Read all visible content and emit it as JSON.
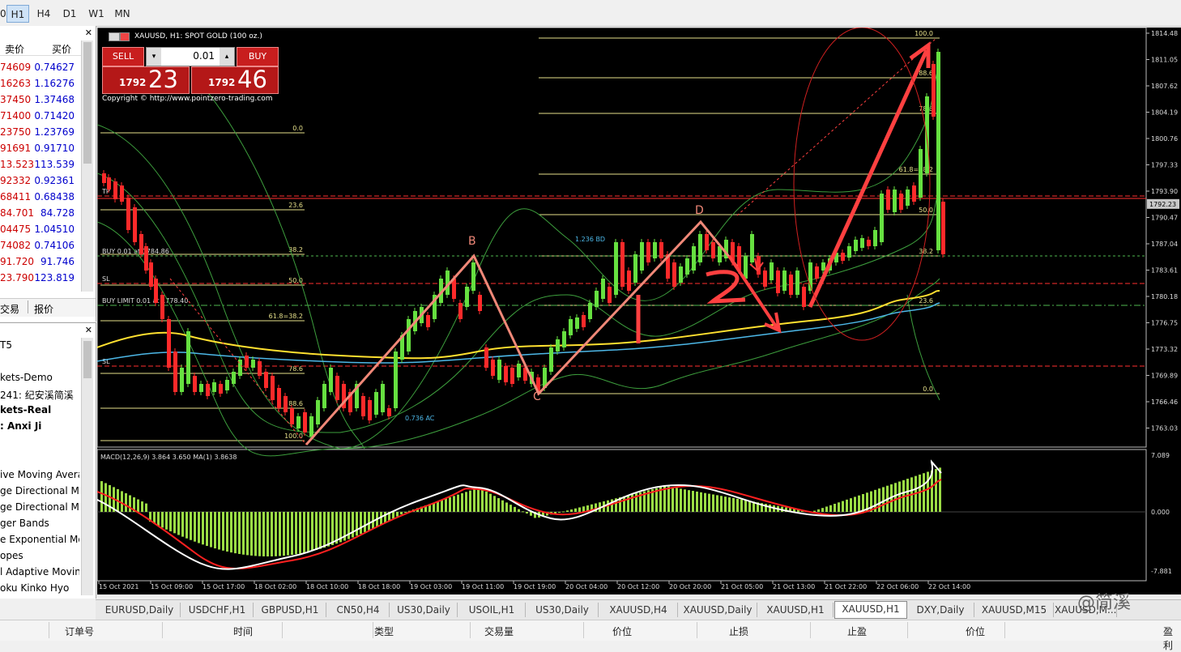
{
  "toolbar": {
    "timeframes": [
      "0",
      "H1",
      "H4",
      "D1",
      "W1",
      "MN"
    ],
    "active": "H1"
  },
  "market_watch": {
    "headers": [
      "卖价",
      "买价"
    ],
    "rows": [
      [
        "74609",
        "0.74627"
      ],
      [
        "16263",
        "1.16276"
      ],
      [
        "37450",
        "1.37468"
      ],
      [
        "71400",
        "0.71420"
      ],
      [
        "23750",
        "1.23769"
      ],
      [
        "91691",
        "0.91710"
      ],
      [
        "13.523",
        "113.539"
      ],
      [
        "92332",
        "0.92361"
      ],
      [
        "68411",
        "0.68438"
      ],
      [
        "84.701",
        "84.728"
      ],
      [
        "04475",
        "1.04510"
      ],
      [
        "74082",
        "0.74106"
      ],
      [
        "91.720",
        "91.746"
      ],
      [
        "23.790",
        "123.819"
      ]
    ],
    "tabs": [
      "交易",
      "报价"
    ]
  },
  "navigator": {
    "items": [
      "T5",
      "kets-Demo",
      "241: 纪安溪简溪",
      "kets-Real",
      ": Anxi Ji",
      "ive Moving Avera",
      "ge Directional Mo",
      "ge Directional Mo",
      "ger Bands",
      "e Exponential Mo",
      "opes",
      "l Adaptive Movin",
      "oku Kinko Hyo"
    ]
  },
  "chart": {
    "title": "XAUUSD, H1:  SPOT GOLD (100 oz.)",
    "sell_label": "SELL",
    "buy_label": "BUY",
    "lot": "0.01",
    "sell_small": "1792",
    "sell_big": "23",
    "buy_small": "1792",
    "buy_big": "46",
    "copyright": "Copyright © http://www.pointzero-trading.com",
    "current_price": "1792.23",
    "price_ticks": [
      "1814.48",
      "1811.05",
      "1807.62",
      "1804.19",
      "1800.76",
      "1797.33",
      "1793.90",
      "1790.47",
      "1787.04",
      "1783.61",
      "1780.18",
      "1776.75",
      "1773.32",
      "1769.89",
      "1766.46",
      "1763.03"
    ],
    "time_ticks": [
      "15 Oct 2021",
      "15 Oct 09:00",
      "15 Oct 17:00",
      "18 Oct 02:00",
      "18 Oct 10:00",
      "18 Oct 18:00",
      "19 Oct 03:00",
      "19 Oct 11:00",
      "19 Oct 19:00",
      "20 Oct 04:00",
      "20 Oct 12:00",
      "20 Oct 20:00",
      "21 Oct 05:00",
      "21 Oct 13:00",
      "21 Oct 22:00",
      "22 Oct 06:00",
      "22 Oct 14:00"
    ],
    "fib_left": [
      "0.0",
      "23.6",
      "38.2",
      "50.0",
      "61.8=38.2",
      "78.6",
      "88.6",
      "100.0"
    ],
    "fib_right": [
      "100.0",
      "88.6",
      "78.6",
      "61.8=38.2",
      "50.0",
      "38.2",
      "23.6",
      "0.0"
    ],
    "order_labels": [
      "TP",
      "BUY 0.01 at 1784.86",
      "SL",
      "BUY LIMIT 0.01 at 1778.40",
      "SL"
    ],
    "point_labels": [
      "B",
      "C",
      "D"
    ],
    "ext_labels": [
      "1.236 BD",
      "0.736 AC"
    ],
    "macd_label": "MACD(12,26,9) 3.864 3.650 MA(1) 3.8638",
    "macd_ticks": [
      "7.089",
      "0.000",
      "-7.881"
    ],
    "colors": {
      "bull": "#66e040",
      "bear": "#ff2a2a",
      "fib": "#e6e08a",
      "ma_yellow": "#ffe030",
      "ma_blue": "#4db8e8",
      "annot": "#ff4040"
    }
  },
  "chart_tabs": [
    "EURUSD,Daily",
    "USDCHF,H1",
    "GBPUSD,H1",
    "CN50,H4",
    "US30,Daily",
    "USOIL,H1",
    "US30,Daily",
    "XAUUSD,H4",
    "XAUUSD,Daily",
    "XAUUSD,H1",
    "XAUUSD,H1",
    "DXY,Daily",
    "XAUUSD,M15",
    "XAUUSD,M..."
  ],
  "chart_tabs_active": 10,
  "watermark": "@简溪",
  "terminal_columns": [
    "订单号",
    "时间",
    "类型",
    "交易量",
    "价位",
    "止损",
    "止盈",
    "价位",
    "盈利"
  ]
}
